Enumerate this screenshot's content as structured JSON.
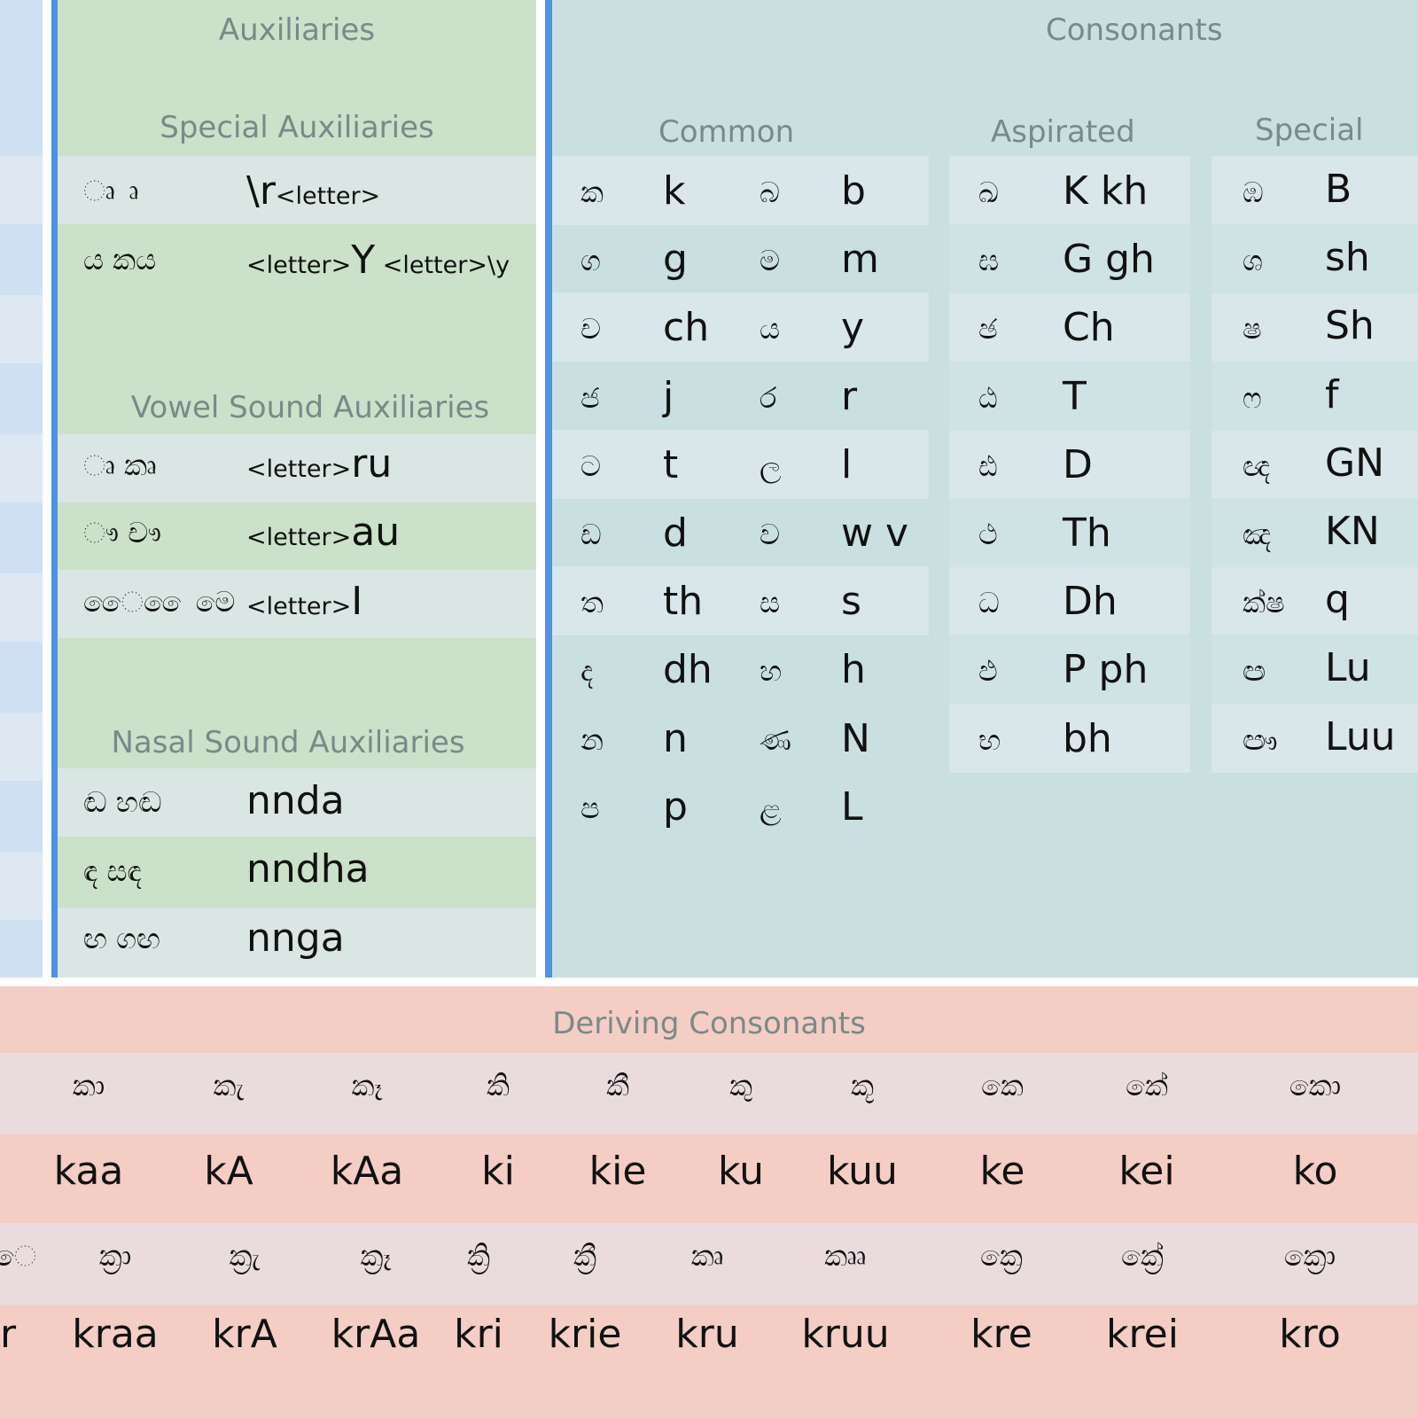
{
  "colors": {
    "left_panel": "#cfe0f2",
    "left_band": "#dde8f3",
    "divider_blue": "#4d93e0",
    "aux_bg": "#cbe1c9",
    "aux_row_light": "#d9e6e3",
    "cons_bg": "#c9dfe0",
    "cons_row_light": "#d9e6ea",
    "deriv_bg": "#f4cdc4",
    "deriv_row_light": "#eadcde",
    "header_text": "#7a8a88"
  },
  "auxiliaries": {
    "title": "Auxiliaries",
    "special_title": "Special Auxiliaries",
    "special_rows": [
      {
        "sinhala": "ෘ ෘ",
        "prefix": "\\r",
        "suffix": "<letter>",
        "tail": ""
      },
      {
        "sinhala": "ය කය",
        "prefix": "<letter>",
        "suffix": "Y",
        "tail": " <letter>\\y"
      }
    ],
    "vowel_title": "Vowel Sound Auxiliaries",
    "vowel_rows": [
      {
        "sinhala": "ෘ කෘ",
        "prefix": "<letter>",
        "suffix": "ru"
      },
      {
        "sinhala": "ෟ චෟ",
        "prefix": "<letter>",
        "suffix": "au"
      },
      {
        "sinhala": "ෛ ෛමෙ",
        "prefix": "<letter>",
        "suffix": "I"
      }
    ],
    "nasal_title": "Nasal Sound Auxiliaries",
    "nasal_rows": [
      {
        "sinhala": "ඬ හඬ",
        "latin": "nnda"
      },
      {
        "sinhala": "ඳ සඳ",
        "latin": "nndha"
      },
      {
        "sinhala": "ඟ ගඟ",
        "latin": "nnga"
      }
    ]
  },
  "consonants": {
    "title": "Consonants",
    "common_title": "Common",
    "aspirated_title": "Aspirated",
    "special_title": "Special",
    "common_rows": [
      {
        "s1": "ක",
        "l1": "k",
        "s2": "බ",
        "l2": "b"
      },
      {
        "s1": "ග",
        "l1": "g",
        "s2": "ම",
        "l2": "m"
      },
      {
        "s1": "ච",
        "l1": "ch",
        "s2": "ය",
        "l2": "y"
      },
      {
        "s1": "ජ",
        "l1": "j",
        "s2": "ර",
        "l2": "r"
      },
      {
        "s1": "ට",
        "l1": "t",
        "s2": "ල",
        "l2": "l"
      },
      {
        "s1": "ඩ",
        "l1": "d",
        "s2": "ව",
        "l2": "w  v"
      },
      {
        "s1": "ත",
        "l1": "th",
        "s2": "ස",
        "l2": "s"
      },
      {
        "s1": "ද",
        "l1": "dh",
        "s2": "හ",
        "l2": "h"
      },
      {
        "s1": "න",
        "l1": "n",
        "s2": "ණ",
        "l2": "N"
      },
      {
        "s1": "ප",
        "l1": "p",
        "s2": "ළ",
        "l2": "L"
      }
    ],
    "aspirated_rows": [
      {
        "s": "ඛ",
        "l": "K  kh"
      },
      {
        "s": "ඝ",
        "l": "G  gh"
      },
      {
        "s": "ඡ",
        "l": "Ch"
      },
      {
        "s": "ඨ",
        "l": "T"
      },
      {
        "s": "ඪ",
        "l": "D"
      },
      {
        "s": "ථ",
        "l": "Th"
      },
      {
        "s": "ධ",
        "l": "Dh"
      },
      {
        "s": "ඵ",
        "l": "P  ph"
      },
      {
        "s": "භ",
        "l": "bh"
      }
    ],
    "special_rows": [
      {
        "s": "ඹ",
        "l": "B"
      },
      {
        "s": "ශ",
        "l": "sh"
      },
      {
        "s": "ෂ",
        "l": "Sh"
      },
      {
        "s": "ෆ",
        "l": "f"
      },
      {
        "s": "ඥ",
        "l": "GN"
      },
      {
        "s": "ඤ",
        "l": "KN"
      },
      {
        "s": "ක්ෂ",
        "l": "q"
      },
      {
        "s": "ඏ",
        "l": "Lu"
      },
      {
        "s": "ඐ",
        "l": "Luu"
      }
    ]
  },
  "deriving": {
    "title": "Deriving Consonants",
    "row1_sinhala": [
      "කා",
      "කැ",
      "කෑ",
      "කි",
      "කී",
      "කු",
      "කූ",
      "කෙ",
      "කේ",
      "කො"
    ],
    "row1_latin": [
      "kaa",
      "kA",
      "kAa",
      "ki",
      "kie",
      "ku",
      "kuu",
      "ke",
      "kei",
      "ko"
    ],
    "row2_lead_sinhala": "ෙ",
    "row2_lead_latin": "r",
    "row2_sinhala": [
      "ක්‍රා",
      "ක්‍රැ",
      "ක්‍රෑ",
      "ක්‍රි",
      "ක්‍රී",
      "කෘ",
      "කෲ",
      "ක්‍රෙ",
      "ක්‍රේ",
      "ක්‍රො"
    ],
    "row2_latin": [
      "kraa",
      "krA",
      "krAa",
      "kri",
      "krie",
      "kru",
      "kruu",
      "kre",
      "krei",
      "kro"
    ]
  }
}
